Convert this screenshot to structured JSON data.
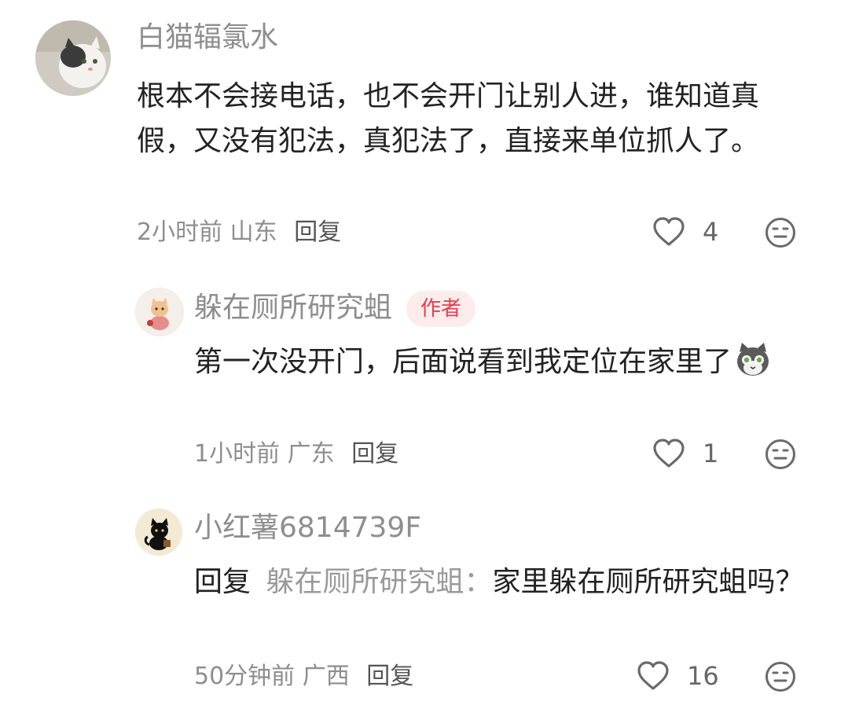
{
  "comments": [
    {
      "username": "白猫辐氯水",
      "text": "根本不会接电话，也不会开门让别人进，谁知道真假，又没有犯法，真犯法了，直接来单位抓人了。",
      "time": "2小时前",
      "location": "山东",
      "reply_label": "回复",
      "likes": "4",
      "avatar_icon": "white-cat-photo-avatar"
    },
    {
      "username": "躲在厕所研究蛆",
      "badge": "作者",
      "text": "第一次没开门，后面说看到我定位在家里了",
      "emoji_icon": "gray-cat-face-sticker",
      "time": "1小时前",
      "location": "广东",
      "reply_label": "回复",
      "likes": "1",
      "avatar_icon": "cartoon-cat-avatar"
    },
    {
      "username": "小红薯6814739F",
      "reply_prefix": "回复",
      "reply_to": "躲在厕所研究蛆：",
      "text": "家里躲在厕所研究蛆吗？",
      "time": "50分钟前",
      "location": "广西",
      "reply_label": "回复",
      "likes": "16",
      "avatar_icon": "black-cat-avatar"
    }
  ],
  "colors": {
    "badge_bg": "#fdecec",
    "badge_text": "#ea3a4f",
    "meta": "#8e8e8e"
  }
}
